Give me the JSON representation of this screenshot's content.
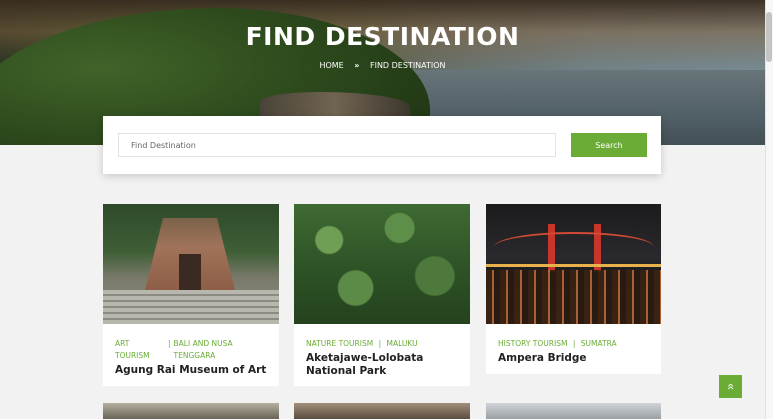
{
  "hero": {
    "title": "FIND DESTINATION",
    "breadcrumb_home": "HOME",
    "breadcrumb_sep": "»",
    "breadcrumb_current": "FIND DESTINATION"
  },
  "search": {
    "placeholder": "Find Destination",
    "button_label": "Search"
  },
  "cards": [
    {
      "category": "ART TOURISM",
      "region": "BALI AND NUSA TENGGARA",
      "title": "Agung Rai Museum of Art"
    },
    {
      "category": "NATURE TOURISM",
      "region": "MALUKU",
      "title": "Aketajawe-Lolobata National Park"
    },
    {
      "category": "HISTORY TOURISM",
      "region": "SUMATRA",
      "title": "Ampera Bridge"
    }
  ],
  "meta_divider": "|",
  "back_to_top_icon": "double-chevron-up-icon",
  "colors": {
    "accent": "#6aac35",
    "background": "#f2f2f2"
  }
}
